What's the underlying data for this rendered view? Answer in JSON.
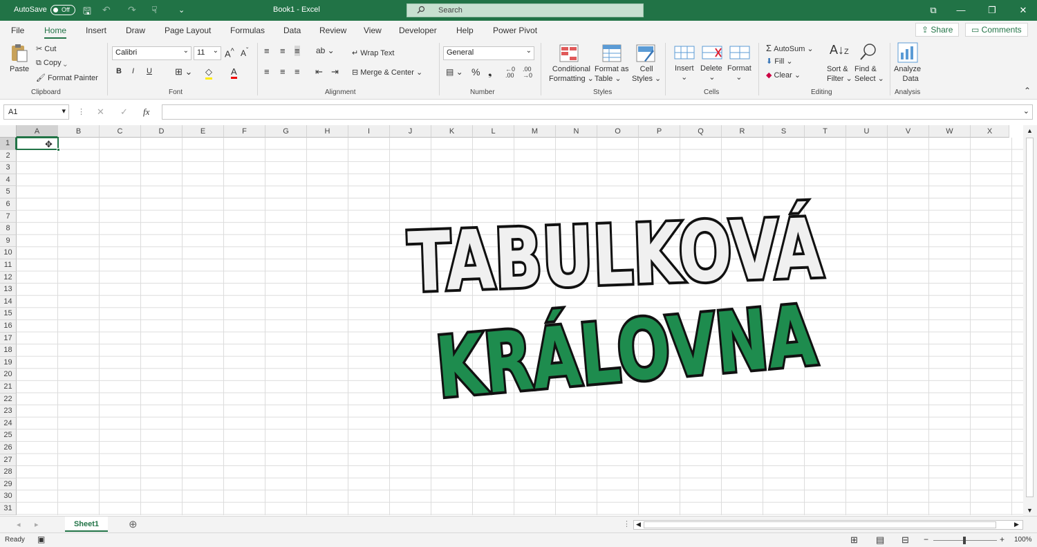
{
  "titlebar": {
    "autosave_label": "AutoSave",
    "autosave_state": "Off",
    "doc_title": "Book1  -  Excel",
    "search_placeholder": "Search"
  },
  "tabs": [
    "File",
    "Home",
    "Insert",
    "Draw",
    "Page Layout",
    "Formulas",
    "Data",
    "Review",
    "View",
    "Developer",
    "Help",
    "Power Pivot"
  ],
  "active_tab": "Home",
  "share_label": "Share",
  "comments_label": "Comments",
  "ribbon": {
    "clipboard": {
      "paste": "Paste",
      "cut": "Cut",
      "copy": "Copy",
      "format_painter": "Format Painter",
      "label": "Clipboard"
    },
    "font": {
      "name": "Calibri",
      "size": "11",
      "bold": "B",
      "italic": "I",
      "underline": "U",
      "label": "Font"
    },
    "alignment": {
      "wrap": "Wrap Text",
      "merge": "Merge & Center",
      "label": "Alignment"
    },
    "number": {
      "format": "General",
      "label": "Number"
    },
    "styles": {
      "conditional_1": "Conditional",
      "conditional_2": "Formatting",
      "format_table_1": "Format as",
      "format_table_2": "Table",
      "cell_styles_1": "Cell",
      "cell_styles_2": "Styles",
      "label": "Styles"
    },
    "cells": {
      "insert": "Insert",
      "delete": "Delete",
      "format": "Format",
      "label": "Cells"
    },
    "editing": {
      "autosum": "AutoSum",
      "fill": "Fill",
      "clear": "Clear",
      "sort_1": "Sort &",
      "sort_2": "Filter",
      "find_1": "Find &",
      "find_2": "Select",
      "label": "Editing"
    },
    "analysis": {
      "analyze_1": "Analyze",
      "analyze_2": "Data",
      "label": "Analysis"
    }
  },
  "formula_bar": {
    "name_box": "A1",
    "fx": "fx"
  },
  "columns": [
    "A",
    "B",
    "C",
    "D",
    "E",
    "F",
    "G",
    "H",
    "I",
    "J",
    "K",
    "L",
    "M",
    "N",
    "O",
    "P",
    "Q",
    "R",
    "S",
    "T",
    "U",
    "V",
    "W",
    "X"
  ],
  "rows": [
    "1",
    "2",
    "3",
    "4",
    "5",
    "6",
    "7",
    "8",
    "9",
    "10",
    "11",
    "12",
    "13",
    "14",
    "15",
    "16",
    "17",
    "18",
    "19",
    "20",
    "21",
    "22",
    "23",
    "24",
    "25",
    "26",
    "27",
    "28",
    "29",
    "30",
    "31"
  ],
  "sheet_tab": "Sheet1",
  "status": {
    "ready": "Ready",
    "zoom": "100%"
  },
  "overlay": {
    "line1": "TABULKOVÁ",
    "line2": "KRÁLOVNA"
  },
  "colors": {
    "accent": "#217346",
    "overlay_fill": "#1e8c4e",
    "overlay_light": "#f2f2f2"
  }
}
